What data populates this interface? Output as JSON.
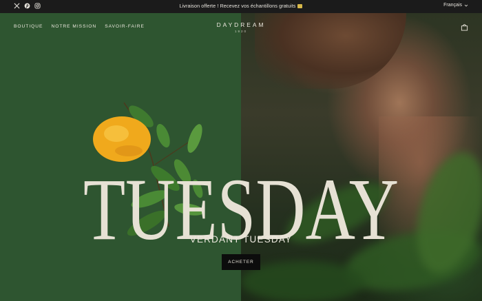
{
  "announcement": {
    "text": "Livraison offerte ! Recevez vos échantillons gratuits"
  },
  "social": {
    "icons": [
      "x-icon",
      "pinterest-icon",
      "instagram-icon"
    ]
  },
  "language": {
    "label": "Français"
  },
  "nav": {
    "items": [
      "BOUTIQUE",
      "NOTRE MISSION",
      "SAVOIR-FAIRE"
    ]
  },
  "brand": {
    "name": "DAYDREAM",
    "year": "1920"
  },
  "hero": {
    "headline": "TUESDAY",
    "subtitle": "VERDANT TUESDAY",
    "cta_label": "ACHETER"
  },
  "colors": {
    "topbar": "#1b1b1b",
    "hero_green": "#2e5530",
    "headline": "#e6e1d4",
    "button": "#0c0c0c"
  }
}
